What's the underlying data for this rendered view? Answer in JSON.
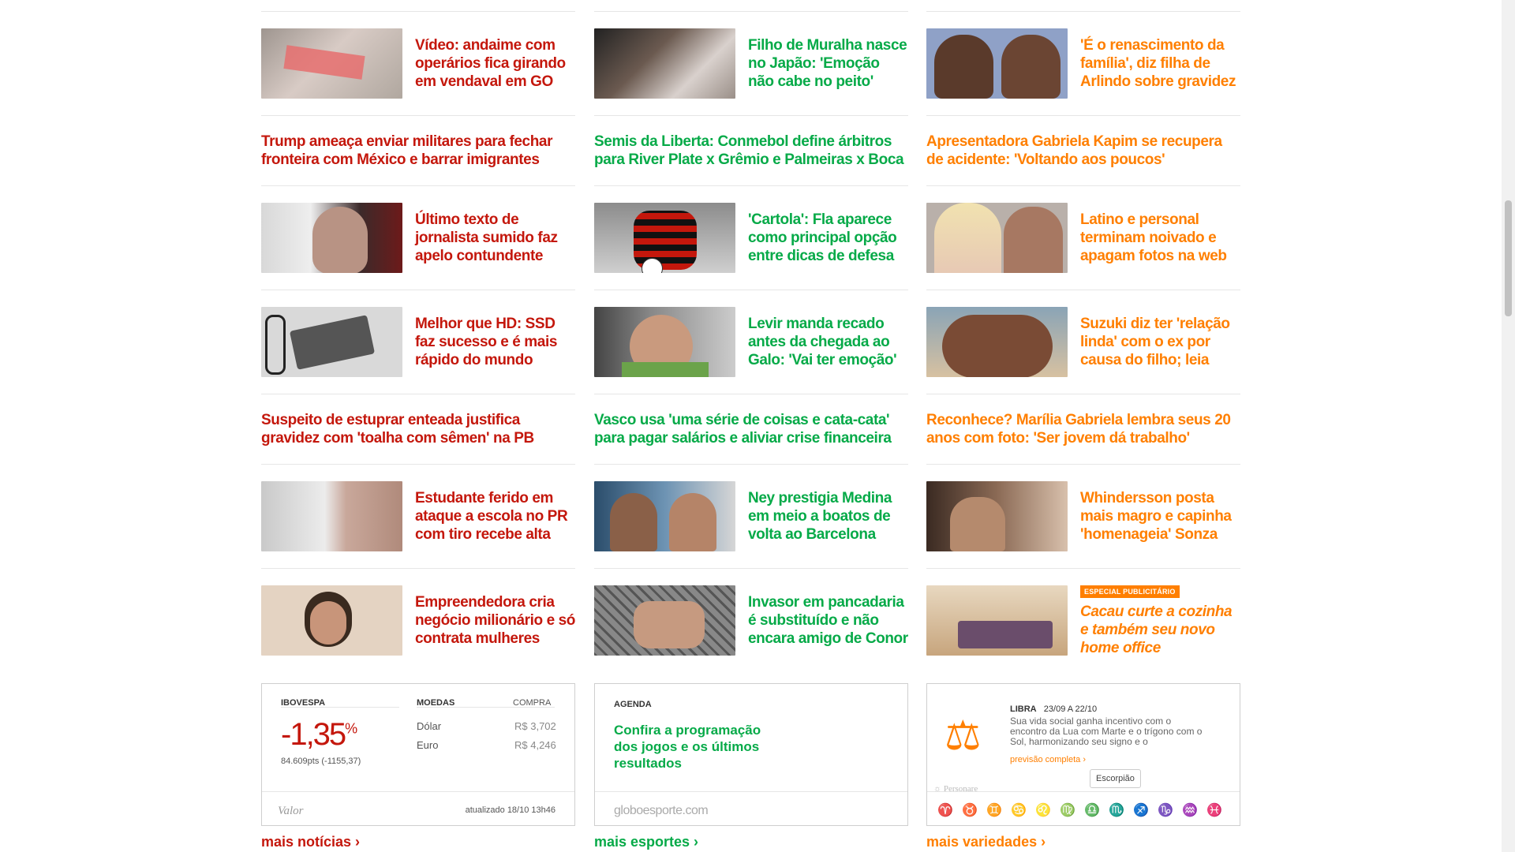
{
  "columns": {
    "news": {
      "items": [
        {
          "kind": "photo",
          "headline": "Vídeo: andaime com operários fica girando em vendaval em GO",
          "image": "scaffold-photo"
        },
        {
          "kind": "text",
          "headline": "Trump ameaça enviar militares para fechar fronteira com México e barrar imigrantes"
        },
        {
          "kind": "photo",
          "headline": "Último texto de jornalista sumido faz apelo contundente",
          "image": "journalist-photo"
        },
        {
          "kind": "photo",
          "headline": "Melhor que HD: SSD faz sucesso e é mais rápido do mundo",
          "image": "ssd-photo"
        },
        {
          "kind": "text",
          "headline": "Suspeito de estuprar enteada justifica gravidez com 'toalha com sêmen' na PB"
        },
        {
          "kind": "photo",
          "headline": "Estudante ferido em ataque a escola no PR com tiro recebe alta",
          "image": "student-photo"
        },
        {
          "kind": "photo",
          "headline": "Empreendedora cria negócio milionário e só contrata mulheres",
          "image": "entrepreneur-photo"
        }
      ],
      "more": "mais notícias ›"
    },
    "sports": {
      "items": [
        {
          "kind": "photo",
          "headline": "Filho de Muralha nasce no Japão: 'Emoção não cabe no peito'",
          "image": "baby-photo"
        },
        {
          "kind": "text",
          "headline": "Semis da Liberta: Conmebol define árbitros para River Plate x Grêmio e Palmeiras x Boca"
        },
        {
          "kind": "photo",
          "headline": "'Cartola': Fla aparece como principal opção entre dicas de defesa",
          "image": "football-photo"
        },
        {
          "kind": "photo",
          "headline": "Levir manda recado antes da chegada ao Galo: 'Vai ter emoção'",
          "image": "coach-photo"
        },
        {
          "kind": "text",
          "headline": "Vasco usa 'uma série de coisas e cata-cata' para pagar salários e aliviar crise financeira"
        },
        {
          "kind": "photo",
          "headline": "Ney prestigia Medina em meio a boatos de volta ao Barcelona",
          "image": "neymar-photo"
        },
        {
          "kind": "photo",
          "headline": "Invasor em pancadaria é substituído e não encara amigo de Conor",
          "image": "mma-photo"
        }
      ],
      "more": "mais esportes ›"
    },
    "entertainment": {
      "items": [
        {
          "kind": "photo",
          "headline": "'É o renascimento da família', diz filha de Arlindo sobre gravidez",
          "image": "family-photo"
        },
        {
          "kind": "text",
          "headline": "Apresentadora Gabriela Kapim se recupera de acidente: 'Voltando aos poucos'"
        },
        {
          "kind": "photo",
          "headline": "Latino e personal terminam noivado e apagam fotos na web",
          "image": "couple-photo"
        },
        {
          "kind": "photo",
          "headline": "Suzuki diz ter 'relação linda' com o ex por causa do filho; leia",
          "image": "beach-photo"
        },
        {
          "kind": "text",
          "headline": "Reconhece? Marília Gabriela lembra seus 20 anos com foto: 'Ser jovem dá trabalho'"
        },
        {
          "kind": "photo",
          "headline": "Whindersson posta mais magro e capinha 'homenageia' Sonza",
          "image": "selfie-photo"
        },
        {
          "kind": "photo",
          "badge": "ESPECIAL PUBLICITÁRIO",
          "headline": "Cacau curte a cozinha e também seu novo home office",
          "image": "room-photo",
          "sponsored": true
        }
      ],
      "more": "mais variedades ›"
    }
  },
  "market": {
    "index_label": "IBOVESPA",
    "index_value": "-1,35",
    "percent": "%",
    "points": "84.609pts (-1155,37)",
    "currencies_label": "MOEDAS",
    "buy_label": "COMPRA",
    "currencies": [
      {
        "name": "Dólar",
        "value": "R$ 3,702"
      },
      {
        "name": "Euro",
        "value": "R$ 4,246"
      }
    ],
    "source": "Valor",
    "updated": "atualizado 18/10 13h46"
  },
  "agenda": {
    "label": "AGENDA",
    "text": "Confira a programação dos jogos e os últimos resultados",
    "source": "globoesporte.com"
  },
  "horoscope": {
    "sign": "LIBRA",
    "dates": "23/09 A 22/10",
    "text": "Sua vida social ganha incentivo com o encontro da Lua com Marte e o trígono com o Sol, harmonizando seu signo e o",
    "link": "previsão completa ›",
    "source": "Personare",
    "tooltip": "Escorpião",
    "signs": [
      "aries-icon",
      "taurus-icon",
      "gemini-icon",
      "cancer-icon",
      "leo-icon",
      "virgo-icon",
      "libra-icon",
      "scorpio-icon",
      "sagittarius-icon",
      "capricorn-icon",
      "aquarius-icon",
      "pisces-icon"
    ],
    "active_sign": "scorpio-icon"
  },
  "colors": {
    "news": "#c4170c",
    "sports": "#06aa48",
    "entertainment": "#ff7f00"
  }
}
